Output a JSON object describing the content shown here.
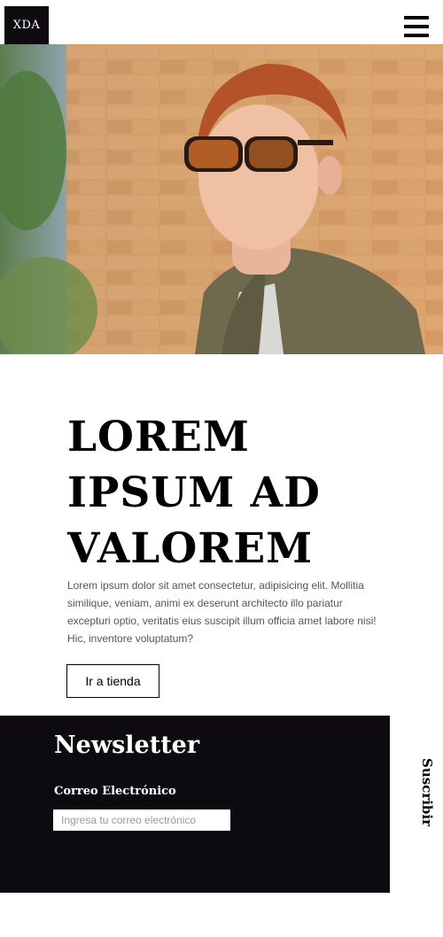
{
  "header": {
    "logo": "XDA",
    "menu_icon": "hamburger-menu-icon"
  },
  "hero": {
    "image_description": ""
  },
  "main": {
    "headline_lines": [
      "LOREM",
      "IPSUM AD",
      "VALOREM"
    ],
    "body": "Lorem ipsum dolor sit amet consectetur, adipisicing elit. Mollitia similique, veniam, animi ex deserunt architecto illo pariatur excepturi optio, veritatis eius suscipit illum officia amet labore nisi! Hic, inventore voluptatum?",
    "button_label": "Ir a tienda"
  },
  "newsletter": {
    "title": "Newsletter",
    "email_label": "Correo Electrónico",
    "email_placeholder": "Ingresa tu correo electrónico",
    "email_value": "",
    "subscribe_label": "Suscribir"
  },
  "colors": {
    "dark": "#0e0b10",
    "background": "#ffffff"
  }
}
